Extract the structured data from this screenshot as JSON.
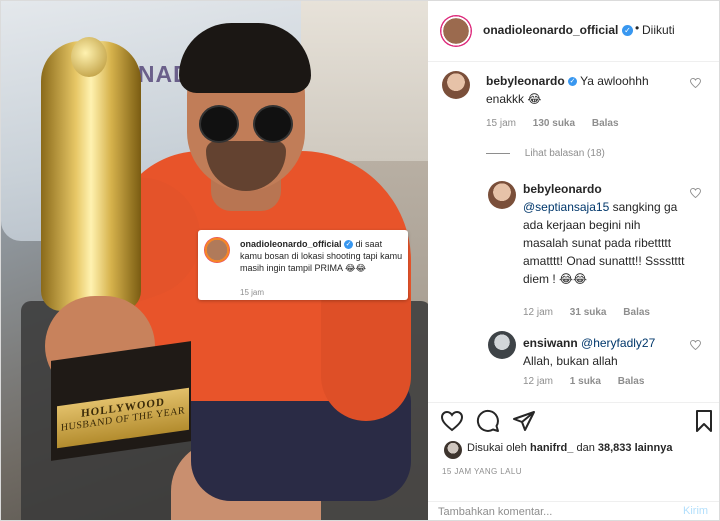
{
  "photo": {
    "jacket_text": "ONADIO",
    "plaque_line1": "HOLLYWOOD",
    "plaque_line2": "HUSBAND OF THE YEAR",
    "caption": {
      "username": "onadioleonardo_official",
      "text": "di saat kamu bosan di lokasi shooting tapi kamu masih ingin tampil PRIMA 😂😂",
      "time": "15 jam"
    }
  },
  "header": {
    "username": "onadioleonardo_official",
    "verified_glyph": "✓",
    "separator": "•",
    "follow_label": "Diikuti"
  },
  "comments": [
    {
      "username": "bebyleonardo",
      "text": "Ya awloohhh enakkk 😂",
      "time": "15 jam",
      "likes": "130 suka",
      "reply_label": "Balas",
      "view_replies": "Lihat balasan (18)"
    },
    {
      "username": "bebyleonardo",
      "mention": "@septiansaja15",
      "text": "sangking ga ada kerjaan begini nih masalah sunat pada ribettttt amatttt! Onad sunattt!! Sssstttt diem ! 😂😂",
      "time": "12 jam",
      "likes": "31 suka",
      "reply_label": "Balas"
    },
    {
      "username": "ensiwann",
      "mention": "@heryfadly27",
      "text": "Allah, bukan allah",
      "time": "12 jam",
      "likes": "1 suka",
      "reply_label": "Balas"
    }
  ],
  "actions": {
    "liked_by_prefix": "Disukai oleh",
    "liked_by_user": "hanifrd_",
    "liked_by_middle": "dan",
    "liked_by_count": "38,833 lainnya",
    "post_time": "15 JAM YANG LALU"
  },
  "comment_box": {
    "placeholder": "Tambahkan komentar...",
    "post_label": "Kirim"
  },
  "colors": {
    "verified_blue": "#3897f0",
    "post_disabled": "#b2dffc",
    "secondary_text": "#8e8e8e",
    "mention": "#00376b"
  },
  "icons": {
    "like": "heart-outline-icon",
    "comment": "speech-bubble-icon",
    "share": "paper-plane-icon",
    "save": "bookmark-icon",
    "comment_like": "small-heart-icon"
  }
}
